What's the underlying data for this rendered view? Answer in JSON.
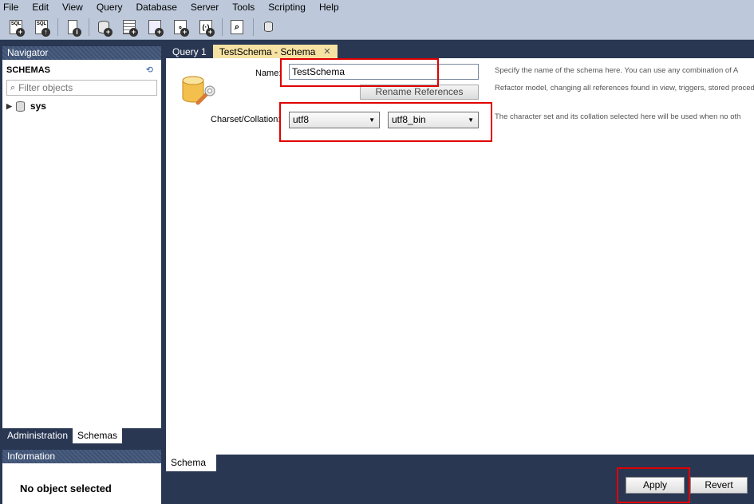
{
  "menu": [
    "File",
    "Edit",
    "View",
    "Query",
    "Database",
    "Server",
    "Tools",
    "Scripting",
    "Help"
  ],
  "toolbar": {
    "icons": [
      "new-sql-tab-icon",
      "open-sql-script-icon",
      "inspector-icon",
      "create-schema-icon",
      "create-table-icon",
      "create-view-icon",
      "create-procedure-icon",
      "create-function-icon",
      "search-table-data-icon",
      "reconnect-icon"
    ]
  },
  "navigator": {
    "title": "Navigator",
    "schemas_label": "SCHEMAS",
    "filter_placeholder": "Filter objects",
    "tree": [
      {
        "label": "sys"
      }
    ],
    "tabs": [
      "Administration",
      "Schemas"
    ],
    "active_tab": "Schemas"
  },
  "information": {
    "title": "Information",
    "message": "No object selected"
  },
  "editor_tabs": [
    {
      "label": "Query 1"
    },
    {
      "label": "TestSchema - Schema"
    }
  ],
  "form": {
    "name_label": "Name:",
    "name_value": "TestSchema",
    "rename_button": "Rename References",
    "charset_label": "Charset/Collation:",
    "charset_value": "utf8",
    "collation_value": "utf8_bin",
    "desc_name": "Specify the name of the schema here. You can use any combination of A",
    "desc_refactor": "Refactor model, changing all references found in view, triggers, stored procedu",
    "desc_charset": "The character set and its collation selected here will be used when no oth"
  },
  "bottom_tab": "Schema",
  "actions": {
    "apply": "Apply",
    "revert": "Revert"
  },
  "colors": {
    "highlight": "#e00000",
    "active_tab": "#f6e2a3",
    "background": "#293753"
  }
}
